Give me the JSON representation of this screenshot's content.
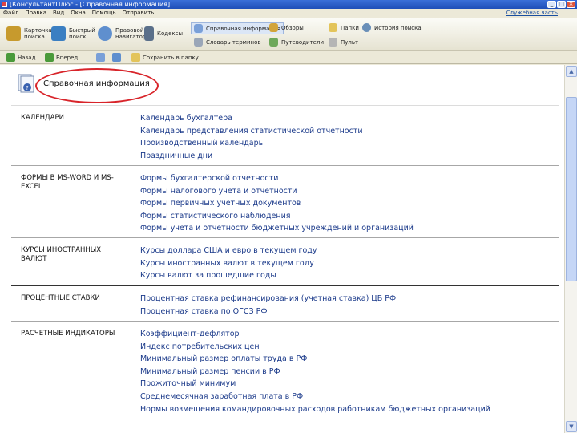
{
  "window": {
    "title": "[КонсультантПлюс - [Справочная информация]"
  },
  "menu": {
    "items": [
      "Файл",
      "Правка",
      "Вид",
      "Окна",
      "Помощь",
      "Отправить"
    ],
    "right": "Служебная часть"
  },
  "toolbar": {
    "items": [
      {
        "label": "Карточка\nпоиска",
        "icon": "search-card-icon",
        "color": "#c79a2d"
      },
      {
        "label": "Быстрый\nпоиск",
        "icon": "quick-search-icon",
        "color": "#3b7fc2"
      },
      {
        "label": "Правовой\nнавигатор",
        "icon": "navigator-icon",
        "color": "#5f8fce"
      },
      {
        "label": "Кодексы",
        "icon": "codes-icon",
        "color": "#5a6f8a"
      }
    ],
    "links": [
      {
        "label": "Справочная информация",
        "icon": "info-icon",
        "color": "#7aa0d8"
      },
      {
        "label": "Обзоры",
        "icon": "reviews-icon",
        "color": "#d2a43a"
      },
      {
        "label": "Папки",
        "icon": "folder-icon",
        "color": "#e3c45a"
      },
      {
        "label": "История поиска",
        "icon": "history-icon",
        "color": "#6a8fb8"
      },
      {
        "label": "Словарь терминов",
        "icon": "dictionary-icon",
        "color": "#9aa6b8"
      },
      {
        "label": "Путеводители",
        "icon": "guide-icon",
        "color": "#6ea85a"
      },
      {
        "label": "Пульт",
        "icon": "remote-icon",
        "color": "#b5b5b5"
      }
    ]
  },
  "nav": {
    "back": "Назад",
    "forward": "Вперед",
    "items": [
      "Назад",
      "Вперед",
      "Печать",
      "Экспорт",
      "Сохранить в папку"
    ]
  },
  "page": {
    "title": "Справочная информация"
  },
  "sections": [
    {
      "category": "КАЛЕНДАРИ",
      "links": [
        "Календарь бухгалтера",
        "Календарь представления статистической отчетности",
        "Производственный календарь",
        "Праздничные дни"
      ]
    },
    {
      "category": "ФОРМЫ В MS-WORD И MS-EXCEL",
      "links": [
        "Формы бухгалтерской отчетности",
        "Формы налогового учета и отчетности",
        "Формы первичных учетных документов",
        "Формы статистического наблюдения",
        "Формы учета и отчетности бюджетных учреждений и организаций"
      ]
    },
    {
      "category": "КУРСЫ ИНОСТРАННЫХ ВАЛЮТ",
      "links": [
        "Курсы доллара США и евро в текущем году",
        "Курсы иностранных валют в текущем году",
        "Курсы валют за прошедшие годы"
      ]
    },
    {
      "category": "ПРОЦЕНТНЫЕ СТАВКИ",
      "links": [
        "Процентная ставка рефинансирования (учетная ставка) ЦБ РФ",
        "Процентная ставка по ОГСЗ РФ"
      ]
    },
    {
      "category": "РАСЧЕТНЫЕ ИНДИКАТОРЫ",
      "links": [
        "Коэффициент-дефлятор",
        "Индекс потребительских цен",
        "Минимальный размер оплаты труда в РФ",
        "Минимальный размер пенсии в РФ",
        "Прожиточный минимум",
        "Среднемесячная заработная плата в РФ",
        "Нормы возмещения командировочных расходов работникам бюджетных организаций"
      ]
    }
  ]
}
